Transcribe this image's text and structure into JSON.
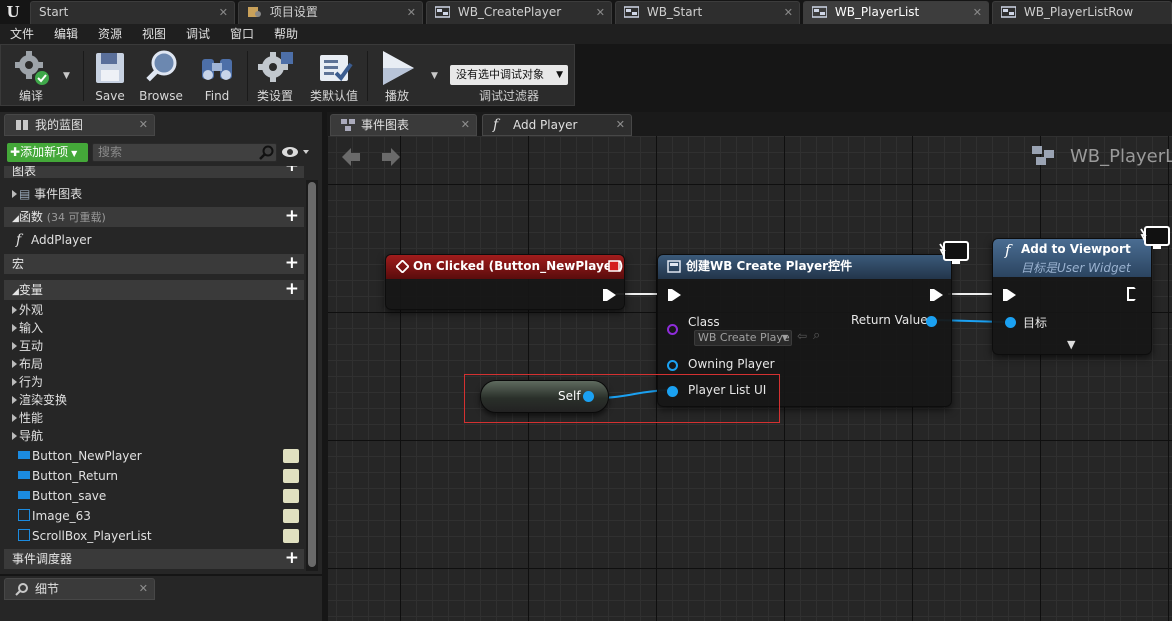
{
  "tabs": [
    {
      "label": "Start",
      "icon": "ue-doc-icon",
      "active": false
    },
    {
      "label": "项目设置",
      "icon": "settings-doc-icon",
      "active": false
    },
    {
      "label": "WB_CreatePlayer",
      "icon": "widget-blueprint-icon",
      "active": false
    },
    {
      "label": "WB_Start",
      "icon": "widget-blueprint-icon",
      "active": false
    },
    {
      "label": "WB_PlayerList",
      "icon": "widget-blueprint-icon",
      "active": true
    },
    {
      "label": "WB_PlayerListRow",
      "icon": "widget-blueprint-icon",
      "active": false
    }
  ],
  "menu": [
    "文件",
    "编辑",
    "资源",
    "视图",
    "调试",
    "窗口",
    "帮助"
  ],
  "toolbar": {
    "compile": "编译",
    "save": "Save",
    "browse": "Browse",
    "find": "Find",
    "class_settings": "类设置",
    "class_defaults": "类默认值",
    "play": "播放",
    "debug_select": "没有选中调试对象",
    "debug_filter": "调试过滤器"
  },
  "left_panel": {
    "tab": "我的蓝图",
    "add_new": "添加新项",
    "search_placeholder": "搜索",
    "graph_section": "图表",
    "event_graph": "事件图表",
    "functions": "函数",
    "functions_count": "(34 可重载)",
    "function_item": "AddPlayer",
    "macros": "宏",
    "variables": "变量",
    "categories": [
      "外观",
      "输入",
      "互动",
      "布局",
      "行为",
      "渲染变换",
      "性能",
      "导航"
    ],
    "variable_items": [
      "Button_NewPlayer",
      "Button_Return",
      "Button_save",
      "Image_63",
      "ScrollBox_PlayerList"
    ],
    "event_dispatchers": "事件调度器"
  },
  "details_panel": {
    "tab": "细节"
  },
  "graph_tabs": [
    {
      "label": "事件图表",
      "active": false
    },
    {
      "label": "Add Player",
      "active": true
    }
  ],
  "graph": {
    "title": "WB_PlayerL",
    "event_node": {
      "title": "On Clicked (Button_NewPlayer)",
      "color": "#7a1414"
    },
    "create_node": {
      "title": "创建WB Create Player控件",
      "class_label": "Class",
      "class_value": "WB Create Playe",
      "owning_player": "Owning Player",
      "player_list_ui": "Player List UI",
      "return_value": "Return Value"
    },
    "viewport_node": {
      "title": "Add to Viewport",
      "subtitle": "目标是User Widget",
      "target": "目标"
    },
    "self_node": {
      "label": "Self"
    }
  },
  "colors": {
    "event_header": "#7a1414",
    "function_header": "#34506e",
    "object_pin": "#1ba1f2",
    "class_pin": "#8e2cd9",
    "add_button": "#44a839",
    "highlight": "#d43131"
  }
}
